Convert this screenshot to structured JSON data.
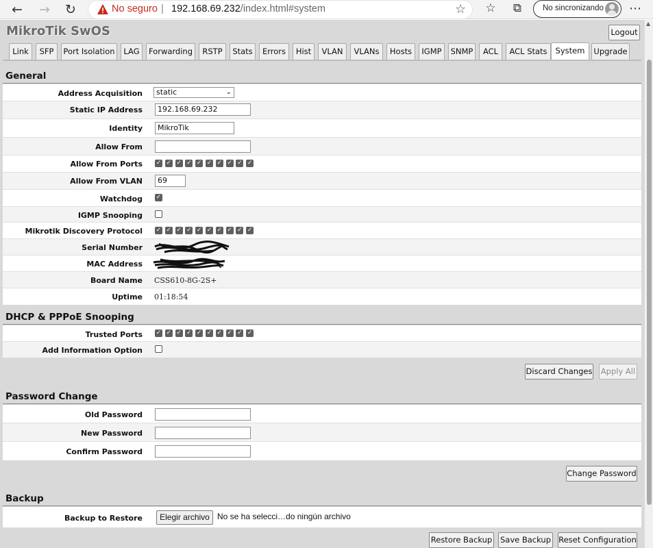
{
  "browser": {
    "security_label": "No seguro",
    "url_separator": "|",
    "url_host": "192.168.69.232",
    "url_path": "/index.html#system",
    "sync_label": "No sincronizando"
  },
  "app": {
    "title": "MikroTik SwOS",
    "logout_label": "Logout"
  },
  "tabs": [
    {
      "label": "Link"
    },
    {
      "label": "SFP"
    },
    {
      "label": "Port Isolation"
    },
    {
      "label": "LAG"
    },
    {
      "label": "Forwarding"
    },
    {
      "label": "RSTP"
    },
    {
      "label": "Stats"
    },
    {
      "label": "Errors"
    },
    {
      "label": "Hist"
    },
    {
      "label": "VLAN"
    },
    {
      "label": "VLANs"
    },
    {
      "label": "Hosts"
    },
    {
      "label": "IGMP"
    },
    {
      "label": "SNMP"
    },
    {
      "label": "ACL"
    },
    {
      "label": "ACL Stats"
    },
    {
      "label": "System",
      "active": true
    },
    {
      "label": "Upgrade"
    }
  ],
  "general": {
    "title": "General",
    "address_acquisition": {
      "label": "Address Acquisition",
      "value": "static"
    },
    "static_ip": {
      "label": "Static IP Address",
      "value": "192.168.69.232"
    },
    "identity": {
      "label": "Identity",
      "value": "MikroTik"
    },
    "allow_from": {
      "label": "Allow From",
      "value": ""
    },
    "allow_from_ports": {
      "label": "Allow From Ports",
      "checked": [
        true,
        true,
        true,
        true,
        true,
        true,
        true,
        true,
        true,
        true
      ]
    },
    "allow_from_vlan": {
      "label": "Allow From VLAN",
      "value": "69"
    },
    "watchdog": {
      "label": "Watchdog",
      "checked": true
    },
    "igmp_snooping": {
      "label": "IGMP Snooping",
      "checked": false
    },
    "mdp": {
      "label": "Mikrotik Discovery Protocol",
      "checked": [
        true,
        true,
        true,
        true,
        true,
        true,
        true,
        true,
        true,
        true
      ]
    },
    "serial_number": {
      "label": "Serial Number"
    },
    "mac_address": {
      "label": "MAC Address"
    },
    "board_name": {
      "label": "Board Name",
      "value": "CSS610-8G-2S+"
    },
    "uptime": {
      "label": "Uptime",
      "value": "01:18:54"
    }
  },
  "dhcp": {
    "title": "DHCP & PPPoE Snooping",
    "trusted_ports": {
      "label": "Trusted Ports",
      "checked": [
        true,
        true,
        true,
        true,
        true,
        true,
        true,
        true,
        true,
        true
      ]
    },
    "add_info_option": {
      "label": "Add Information Option",
      "checked": false
    },
    "discard_label": "Discard Changes",
    "apply_label": "Apply All"
  },
  "password": {
    "title": "Password Change",
    "old_label": "Old Password",
    "new_label": "New Password",
    "confirm_label": "Confirm Password",
    "change_label": "Change Password"
  },
  "backup": {
    "title": "Backup",
    "restore_label": "Backup to Restore",
    "choose_file_label": "Elegir archivo",
    "no_file_label": "No se ha selecci…do ningún archivo",
    "restore_button": "Restore Backup",
    "save_button": "Save Backup",
    "reset_button": "Reset Configuration"
  }
}
